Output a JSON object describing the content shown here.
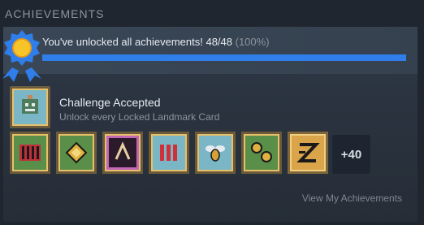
{
  "section": {
    "title": "ACHIEVEMENTS"
  },
  "progress": {
    "text": "You've unlocked all achievements! 48/48",
    "percent_label": "(100%)",
    "unlocked": 48,
    "total": 48,
    "fraction": 1.0
  },
  "featured": {
    "title": "Challenge Accepted",
    "description": "Unlock every Locked Landmark Card",
    "icon": "robot-face-icon"
  },
  "achievements": [
    {
      "icon": "red-barrier-icon",
      "color": "#5a8f4a"
    },
    {
      "icon": "gold-gem-icon",
      "color": "#5a8f4a"
    },
    {
      "icon": "black-pickaxe-icon",
      "color": "#c267b6"
    },
    {
      "icon": "red-bars-icon",
      "color": "#7ab6c6"
    },
    {
      "icon": "bee-icon",
      "color": "#7ab6c6"
    },
    {
      "icon": "gold-coins-icon",
      "color": "#5a8f4a"
    },
    {
      "icon": "black-glyph-icon",
      "color": "#d9a44a"
    }
  ],
  "more": {
    "label": "+40"
  },
  "footer": {
    "link": "View My Achievements"
  },
  "colors": {
    "accent": "#2f7eea",
    "glow": "#e8a83a"
  }
}
